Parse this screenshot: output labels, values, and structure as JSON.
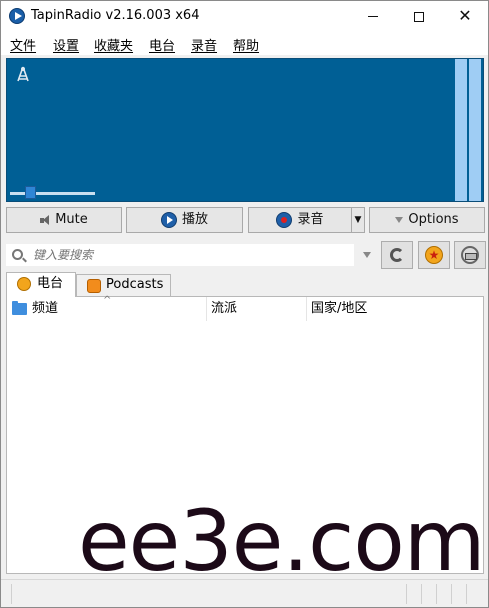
{
  "window": {
    "title": "TapinRadio v2.16.003    x64"
  },
  "menu": {
    "items": [
      "文件",
      "设置",
      "收藏夹",
      "电台",
      "录音",
      "帮助"
    ]
  },
  "player": {
    "volume_fraction": 0.2
  },
  "controls": {
    "mute_label": "Mute",
    "play_label": "播放",
    "record_label": "录音",
    "options_label": "Options"
  },
  "search": {
    "placeholder": "键入要搜索"
  },
  "tabs": {
    "station": "电台",
    "podcasts": "Podcasts"
  },
  "list": {
    "columns": [
      "频道",
      "流派",
      "国家/地区"
    ]
  },
  "watermark": {
    "text": "ee3e.com"
  },
  "colors": {
    "visualizer_bg": "#005f95",
    "vu_meter": "#9fcdf4",
    "accent_blue": "#1f5fa8"
  }
}
